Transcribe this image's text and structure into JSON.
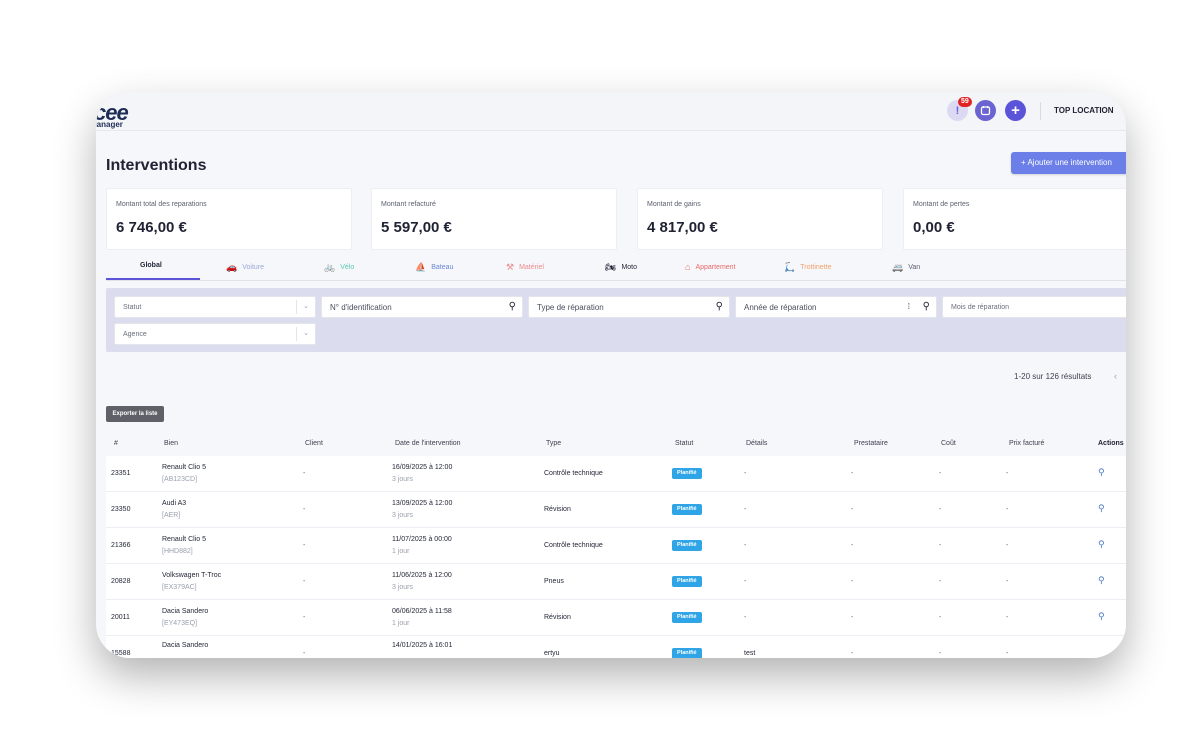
{
  "app": {
    "logo_main": "cee",
    "logo_sub": "Manager",
    "notifications_count": "59",
    "account": "TOP LOCATION"
  },
  "page": {
    "title": "Interventions",
    "add_button": "+ Ajouter une intervention"
  },
  "stats": [
    {
      "label": "Montant total des reparations",
      "value": "6 746,00 €"
    },
    {
      "label": "Montant refacturé",
      "value": "5 597,00 €"
    },
    {
      "label": "Montant de gains",
      "value": "4 817,00 €"
    },
    {
      "label": "Montant de pertes",
      "value": "0,00 €"
    }
  ],
  "tabs": [
    {
      "label": "Global",
      "icon": "",
      "color": "#1f2233",
      "active": true
    },
    {
      "label": "Voiture",
      "icon": "car-icon",
      "color": "#9aa8d8"
    },
    {
      "label": "Vélo",
      "icon": "bike-icon",
      "color": "#5bc8b8"
    },
    {
      "label": "Bateau",
      "icon": "boat-icon",
      "color": "#6a86d6"
    },
    {
      "label": "Matériel",
      "icon": "tools-icon",
      "color": "#e98c8c"
    },
    {
      "label": "Moto",
      "icon": "motorbike-icon",
      "color": "#1f2233"
    },
    {
      "label": "Appartement",
      "icon": "house-icon",
      "color": "#e96a6a"
    },
    {
      "label": "Trottinette",
      "icon": "scooter-icon",
      "color": "#f2a06a"
    },
    {
      "label": "Van",
      "icon": "van-icon",
      "color": "#5c6070"
    }
  ],
  "filters": {
    "statut": "Statut",
    "identification": "N° d'identification",
    "type": "Type de réparation",
    "annee": "Année de réparation",
    "mois": "Mois de réparation",
    "agence": "Agence"
  },
  "results_text": "1-20 sur 126 résultats",
  "export_label": "Exporter la liste",
  "columns": [
    "#",
    "Bien",
    "Client",
    "Date de l'intervention",
    "Type",
    "Statut",
    "Détails",
    "Prestataire",
    "Coût",
    "Prix facturé",
    "Actions"
  ],
  "rows": [
    {
      "id": "23351",
      "bien": "Renault Clio 5",
      "plate": "[AB123CD]",
      "client": "-",
      "date": "16/09/2025 à 12:00",
      "delay": "3 jours",
      "type": "Contrôle technique",
      "statut": "Planifié",
      "details": "-",
      "prestataire": "-",
      "cout": "-",
      "prix": "-"
    },
    {
      "id": "23350",
      "bien": "Audi A3",
      "plate": "[AER]",
      "client": "-",
      "date": "13/09/2025 à 12:00",
      "delay": "3 jours",
      "type": "Révision",
      "statut": "Planifié",
      "details": "-",
      "prestataire": "-",
      "cout": "-",
      "prix": "-"
    },
    {
      "id": "21366",
      "bien": "Renault Clio 5",
      "plate": "[HHD882]",
      "client": "-",
      "date": "11/07/2025 à 00:00",
      "delay": "1 jour",
      "type": "Contrôle technique",
      "statut": "Planifié",
      "details": "-",
      "prestataire": "-",
      "cout": "-",
      "prix": "-"
    },
    {
      "id": "20828",
      "bien": "Volkswagen T-Troc",
      "plate": "[EX379AC]",
      "client": "-",
      "date": "11/06/2025 à 12:00",
      "delay": "3 jours",
      "type": "Pneus",
      "statut": "Planifié",
      "details": "-",
      "prestataire": "-",
      "cout": "-",
      "prix": "-"
    },
    {
      "id": "20011",
      "bien": "Dacia Sandero",
      "plate": "[EY473EQ]",
      "client": "-",
      "date": "06/06/2025 à 11:58",
      "delay": "1 jour",
      "type": "Révision",
      "statut": "Planifié",
      "details": "-",
      "prestataire": "-",
      "cout": "-",
      "prix": "-"
    },
    {
      "id": "15588",
      "bien": "Dacia Sandero",
      "plate": "",
      "client": "-",
      "date": "14/01/2025 à 16:01",
      "delay": "",
      "type": "ertyu",
      "statut": "Planifié",
      "details": "test",
      "prestataire": "-",
      "cout": "-",
      "prix": "-"
    }
  ]
}
